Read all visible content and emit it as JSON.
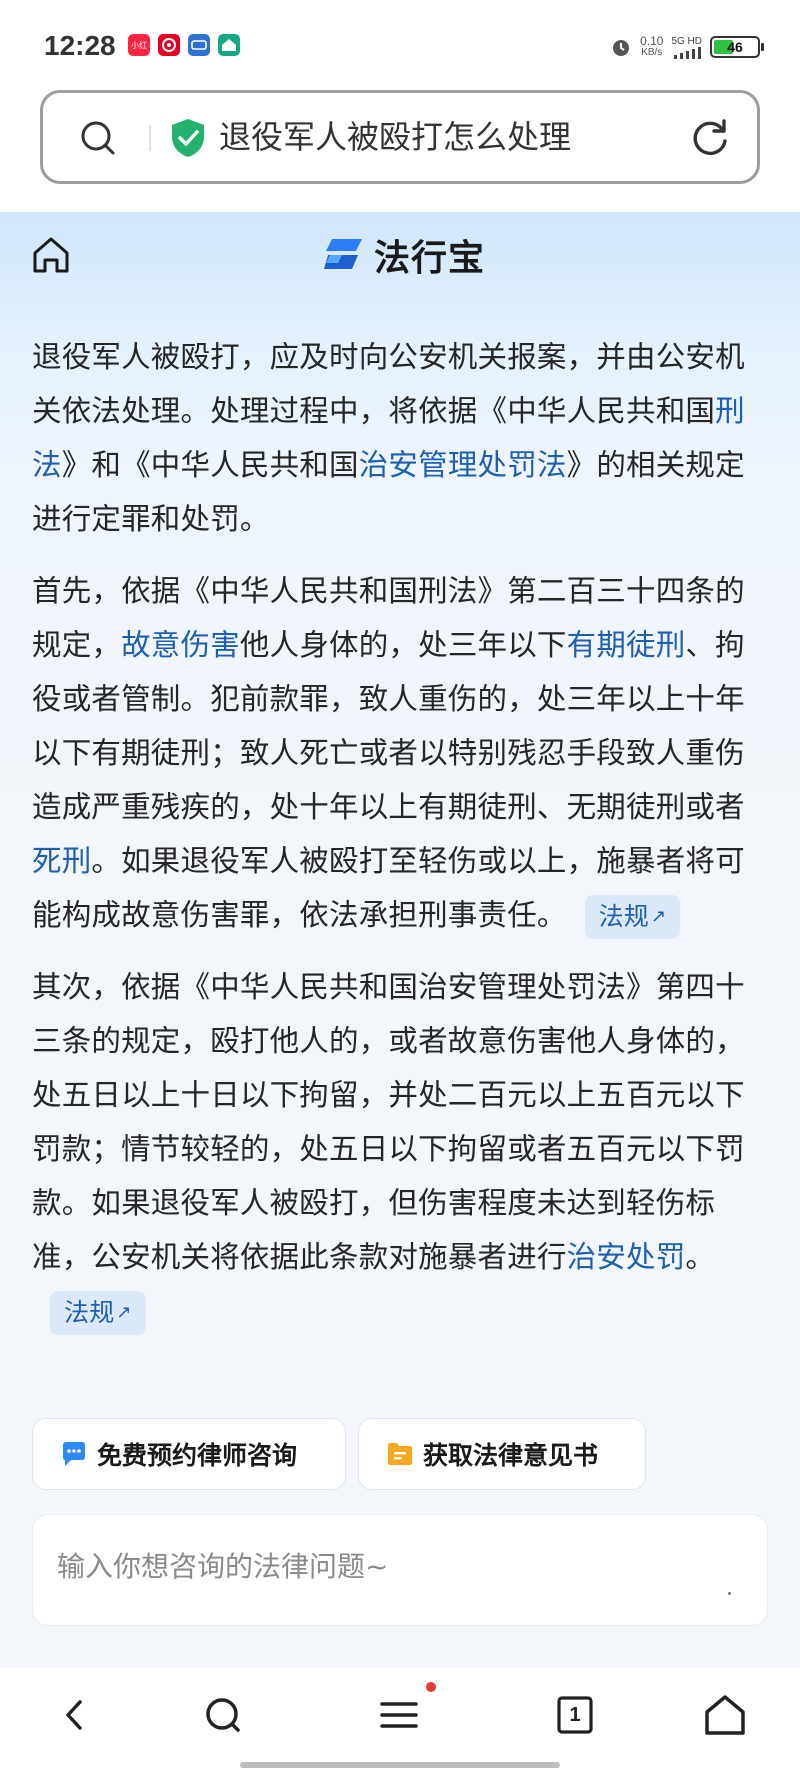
{
  "status_bar": {
    "time": "12:28",
    "notifications": [
      {
        "icon": "xiaohongshu-icon",
        "label": "小红书",
        "color": "#ff2442"
      },
      {
        "icon": "netease-music-icon",
        "label": "",
        "color": "#e60026"
      },
      {
        "icon": "app-icon",
        "label": "",
        "color": "#2f6fd6"
      },
      {
        "icon": "home-app-icon",
        "label": "",
        "color": "#17a985"
      }
    ],
    "net_speed_value": "0.10",
    "net_speed_unit": "KB/s",
    "signal_label": "5G HD",
    "battery_level": "46",
    "battery_fraction": 0.46
  },
  "address_bar": {
    "query": "退役军人被殴打怎么处理"
  },
  "site": {
    "logo_text": "法行宝"
  },
  "content": {
    "p1": {
      "t1": "退役军人被殴打，应及时向公安机关报案，并由公安机关依法处理。处理过程中，将依据《中华人民共和国",
      "l1": "刑法",
      "t2": "》和《中华人民共和国",
      "l2": "治安管理处罚法",
      "t3": "》的相关规定进行定罪和处罚。"
    },
    "p2": {
      "t1": "首先，依据《中华人民共和国刑法》第二百三十四条的规定，",
      "l1": "故意伤害",
      "t2": "他人身体的，处三年以下",
      "l2": "有期徒刑",
      "t3": "、拘役或者管制。犯前款罪，致人重伤的，处三年以上十年以下有期徒刑；致人死亡或者以特别残忍手段致人重伤造成严重残疾的，处十年以上有期徒刑、无期徒刑或者",
      "l3": "死刑",
      "t4": "。如果退役军人被殴打至轻伤或以上，施暴者将可能构成故意伤害罪，依法承担刑事责任。",
      "tag": "法规"
    },
    "p3": {
      "t1": "其次，依据《中华人民共和国治安管理处罚法》第四十三条的规定，殴打他人的，或者故意伤害他人身体的，处五日以上十日以下拘留，并处二百元以上五百元以下罚款；情节较轻的，处五日以下拘留或者五百元以下罚款。如果退役军人被殴打，但伤害程度未达到轻伤标准，公安机关将依据此条款对施暴者进行",
      "l1": "治安处罚",
      "t2": "。",
      "tag": "法规"
    }
  },
  "actions": {
    "consult_label": "免费预约律师咨询",
    "opinion_label": "获取法律意见书"
  },
  "ask": {
    "placeholder": "输入你想咨询的法律问题~"
  },
  "bottom_nav": {
    "tab_count": "1",
    "colors": {
      "accent": "#1d5fb0",
      "badge": "#e53935"
    }
  }
}
